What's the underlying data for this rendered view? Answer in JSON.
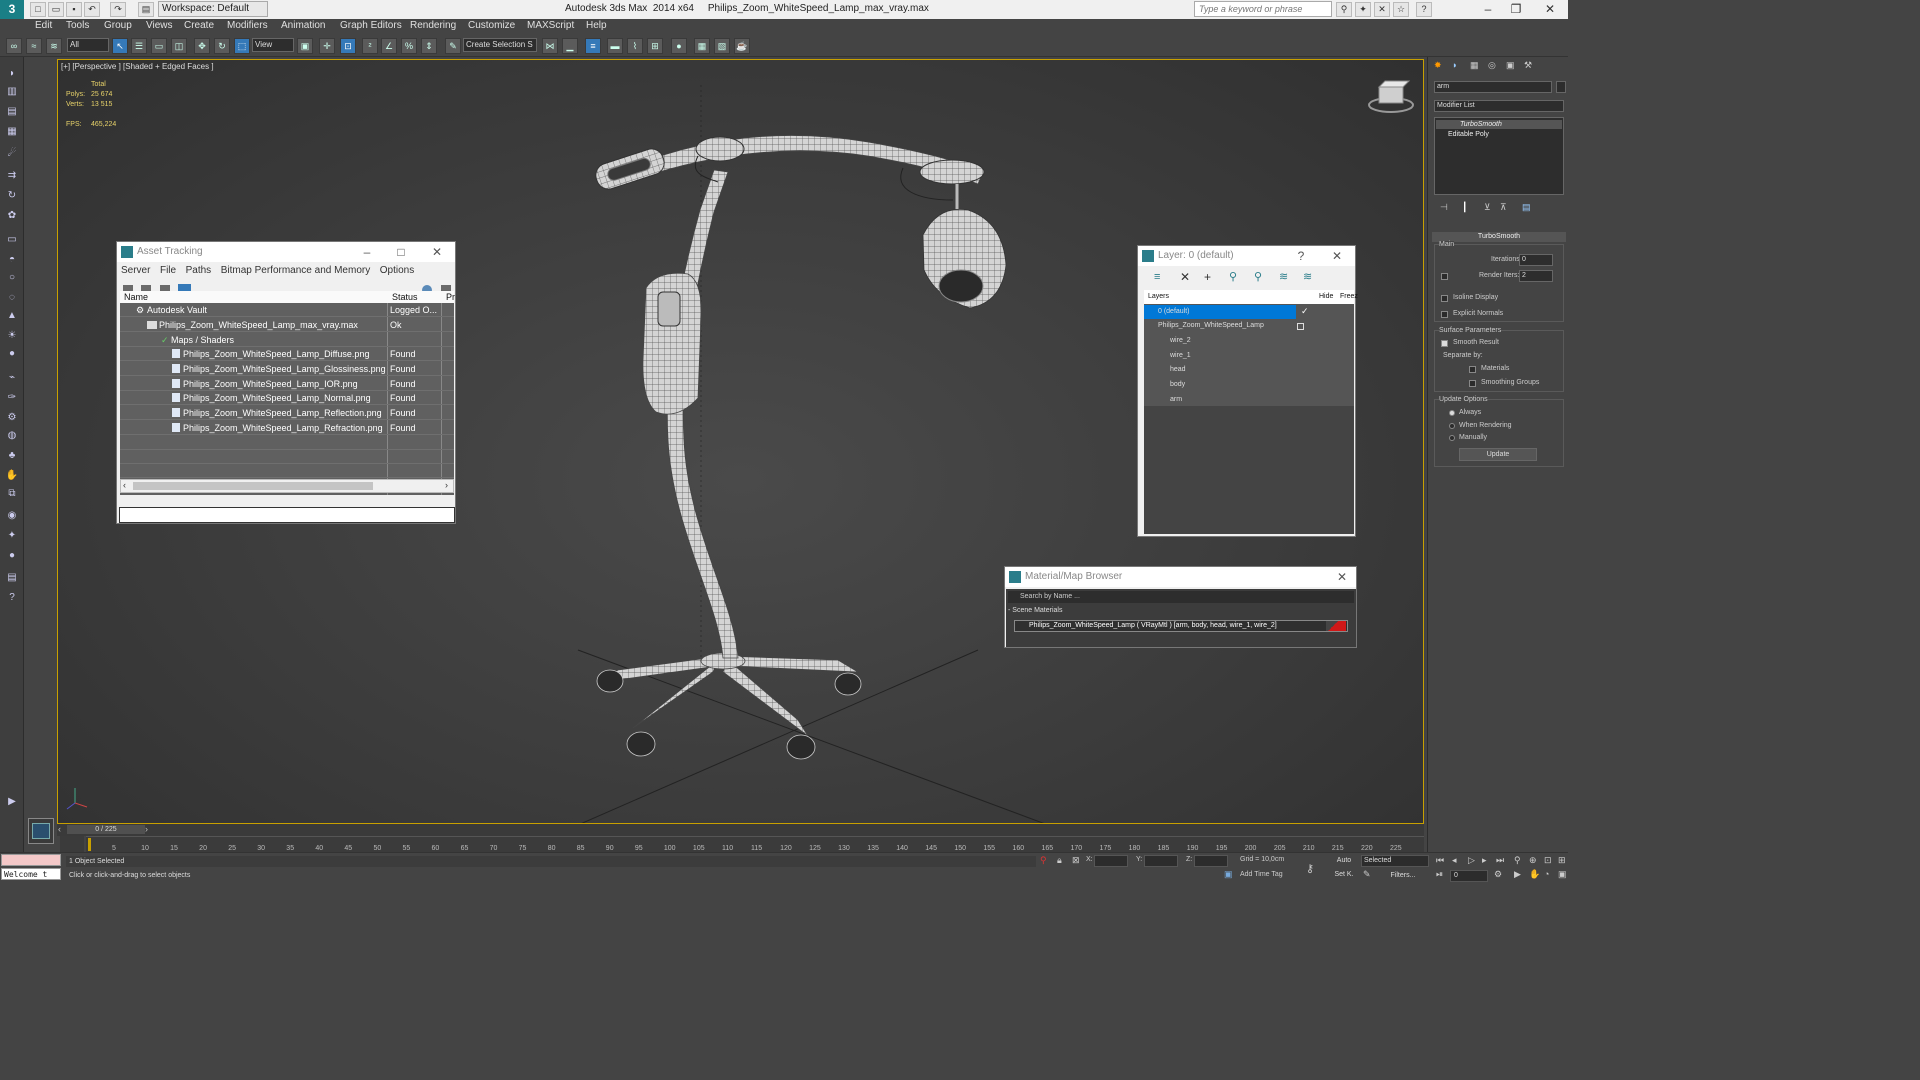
{
  "titlebar": {
    "workspace": "Workspace: Default",
    "app_title": "Autodesk 3ds Max  2014 x64     Philips_Zoom_WhiteSpeed_Lamp_max_vray.max",
    "search_placeholder": "Type a keyword or phrase"
  },
  "menu": [
    "Edit",
    "Tools",
    "Group",
    "Views",
    "Create",
    "Modifiers",
    "Animation",
    "Graph Editors",
    "Rendering",
    "Customize",
    "MAXScript",
    "Help"
  ],
  "toolbar": {
    "selection_filter": "All",
    "ref_coord": "View",
    "named_selection": "Create Selection S"
  },
  "viewport": {
    "label": "[+] [Perspective ] [Shaded + Edged Faces ]",
    "stats": {
      "total_label": "Total",
      "polys_label": "Polys:",
      "polys_value": "25 674",
      "verts_label": "Verts:",
      "verts_value": "13 515",
      "fps_label": "FPS:",
      "fps_value": "465,224"
    }
  },
  "asset_tracking": {
    "title": "Asset Tracking",
    "menu": [
      "Server",
      "File",
      "Paths",
      "Bitmap Performance and Memory",
      "Options"
    ],
    "columns": {
      "name": "Name",
      "status": "Status",
      "extra": "Pr"
    },
    "rows": [
      {
        "name": "Autodesk Vault",
        "status": "Logged O..."
      },
      {
        "name": "Philips_Zoom_WhiteSpeed_Lamp_max_vray.max",
        "status": "Ok"
      },
      {
        "name": "Maps / Shaders",
        "status": ""
      },
      {
        "name": "Philips_Zoom_WhiteSpeed_Lamp_Diffuse.png",
        "status": "Found"
      },
      {
        "name": "Philips_Zoom_WhiteSpeed_Lamp_Glossiness.png",
        "status": "Found"
      },
      {
        "name": "Philips_Zoom_WhiteSpeed_Lamp_IOR.png",
        "status": "Found"
      },
      {
        "name": "Philips_Zoom_WhiteSpeed_Lamp_Normal.png",
        "status": "Found"
      },
      {
        "name": "Philips_Zoom_WhiteSpeed_Lamp_Reflection.png",
        "status": "Found"
      },
      {
        "name": "Philips_Zoom_WhiteSpeed_Lamp_Refraction.png",
        "status": "Found"
      }
    ]
  },
  "layer_dialog": {
    "title": "Layer: 0 (default)",
    "columns": {
      "layers": "Layers",
      "hide": "Hide",
      "freeze": "Freez"
    },
    "rows": [
      "0 (default)",
      "Philips_Zoom_WhiteSpeed_Lamp",
      "wire_2",
      "wire_1",
      "head",
      "body",
      "arm"
    ]
  },
  "material_browser": {
    "title": "Material/Map Browser",
    "search_placeholder": "Search by Name ...",
    "section": "- Scene Materials",
    "item": "Philips_Zoom_WhiteSpeed_Lamp  ( VRayMtl ) [arm, body, head, wire_1, wire_2]"
  },
  "command_panel": {
    "object_name": "arm",
    "modifier_list": "Modifier List",
    "stack": [
      "TurboSmooth",
      "Editable Poly"
    ],
    "rollout_title": "TurboSmooth",
    "main_label": "Main",
    "iterations_label": "Iterations:",
    "iterations_value": "0",
    "render_iters_label": "Render Iters:",
    "render_iters_value": "2",
    "isoline": "Isoline Display",
    "explicit_normals": "Explicit Normals",
    "surface_params": "Surface Parameters",
    "smooth_result": "Smooth Result",
    "separate_by": "Separate by:",
    "materials": "Materials",
    "smoothing_groups": "Smoothing Groups",
    "update_options": "Update Options",
    "always": "Always",
    "when_rendering": "When Rendering",
    "manually": "Manually",
    "update_button": "Update"
  },
  "timeline": {
    "frame": "0 / 225",
    "ticks": [
      "5",
      "10",
      "15",
      "20",
      "25",
      "30",
      "35",
      "40",
      "45",
      "50",
      "55",
      "60",
      "65",
      "70",
      "75",
      "80",
      "85",
      "90",
      "95",
      "100",
      "105",
      "110",
      "115",
      "120",
      "125",
      "130",
      "135",
      "140",
      "145",
      "150",
      "155",
      "160",
      "165",
      "170",
      "175",
      "180",
      "185",
      "190",
      "195",
      "200",
      "205",
      "210",
      "215",
      "220",
      "225"
    ]
  },
  "status": {
    "welcome": "Welcome t",
    "selected": "1 Object Selected",
    "prompt": "Click or click-and-drag to select objects",
    "x_label": "X:",
    "y_label": "Y:",
    "z_label": "Z:",
    "grid": "Grid = 10,0cm",
    "add_time_tag": "Add Time Tag",
    "auto": "Auto",
    "set_key": "Set K.",
    "selected_dropdown": "Selected",
    "filters": "Filters...",
    "frame_field": "0"
  },
  "colors": {
    "accent": "#1a7f86",
    "viewport_border": "#c8a000",
    "selection_blue": "#0078d7",
    "stat_yellow": "#e8d36a"
  }
}
